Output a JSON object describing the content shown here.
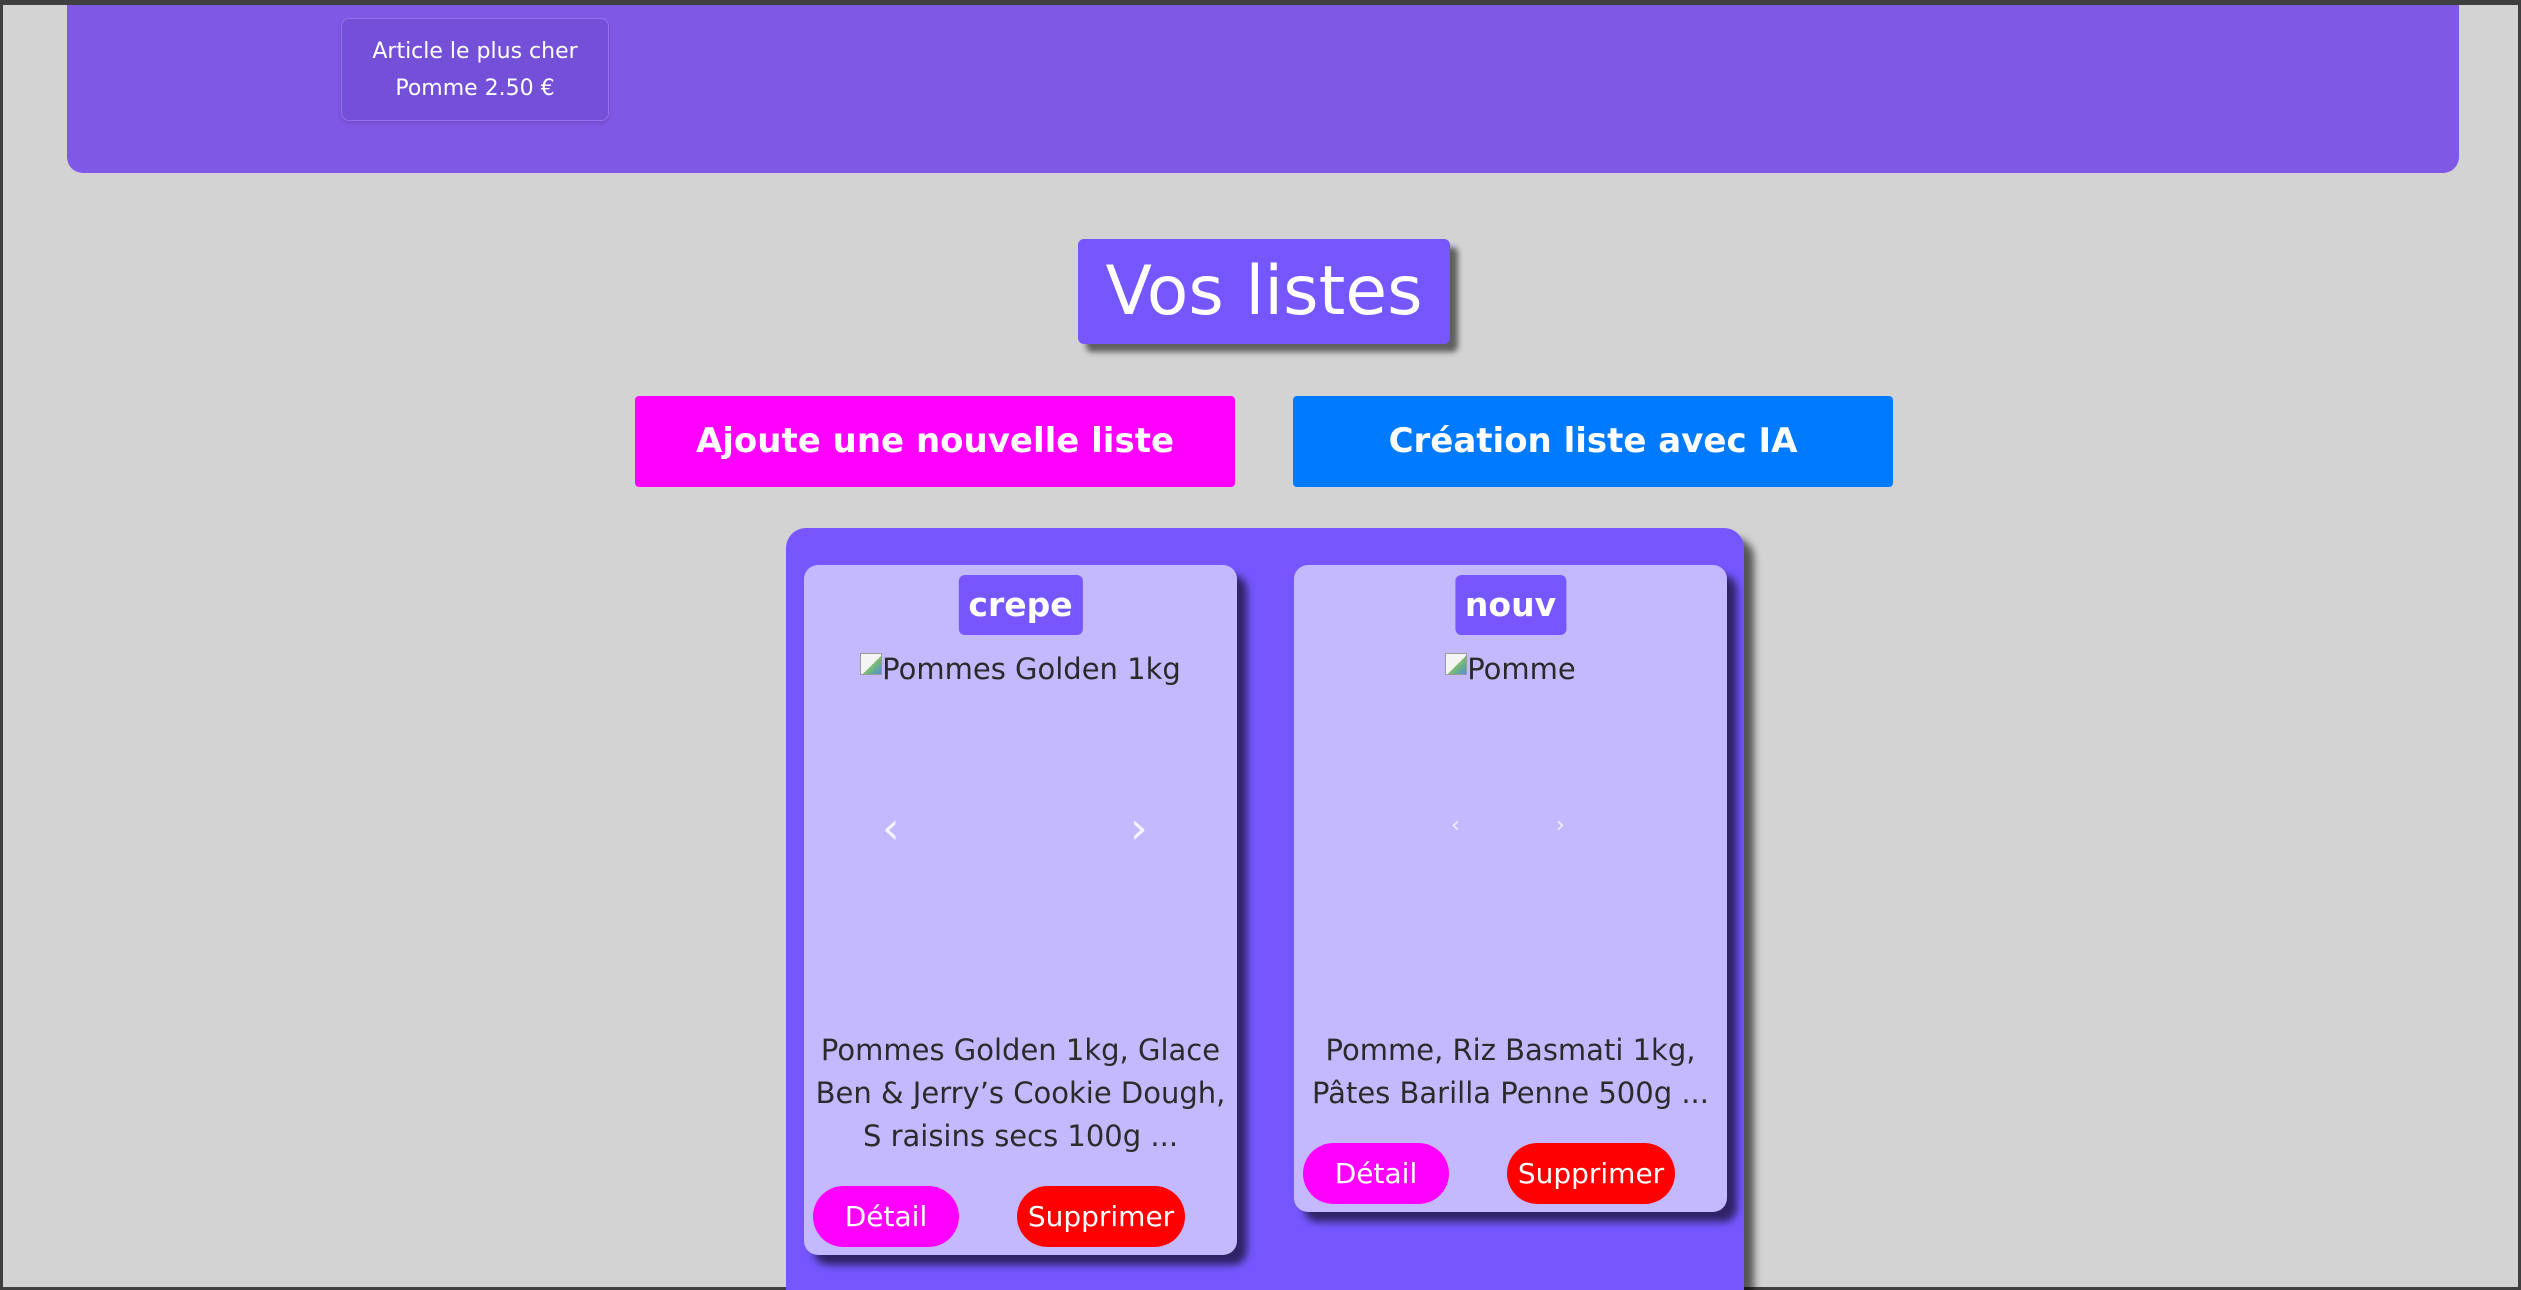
{
  "header": {
    "stat_label": "Article le plus cher",
    "stat_value": "Pomme 2.50 €"
  },
  "main": {
    "title": "Vos listes",
    "add_list_button": "Ajoute une nouvelle liste",
    "ai_list_button": "Création liste avec IA"
  },
  "lists": [
    {
      "name": "crepe",
      "image_alt": "Pommes Golden 1kg",
      "description": "Pommes Golden 1kg, Glace Ben & Jerry’s Cookie Dough, S raisins secs 100g ...",
      "detail_label": "Détail",
      "delete_label": "Supprimer"
    },
    {
      "name": "nouv",
      "image_alt": "Pomme",
      "description": "Pomme, Riz Basmati 1kg, Pâtes Barilla Penne 500g ...",
      "detail_label": "Détail",
      "delete_label": "Supprimer"
    }
  ],
  "icons": {
    "prev": "chevron-left-icon",
    "next": "chevron-right-icon",
    "broken_image": "broken-image-icon"
  },
  "colors": {
    "background": "#d3d3d3",
    "banner": "#8058e6",
    "accent_purple": "#7657ff",
    "card_bg": "#c4b9ff",
    "magenta": "#ff00ff",
    "blue": "#007bff",
    "red": "#ff0000"
  }
}
